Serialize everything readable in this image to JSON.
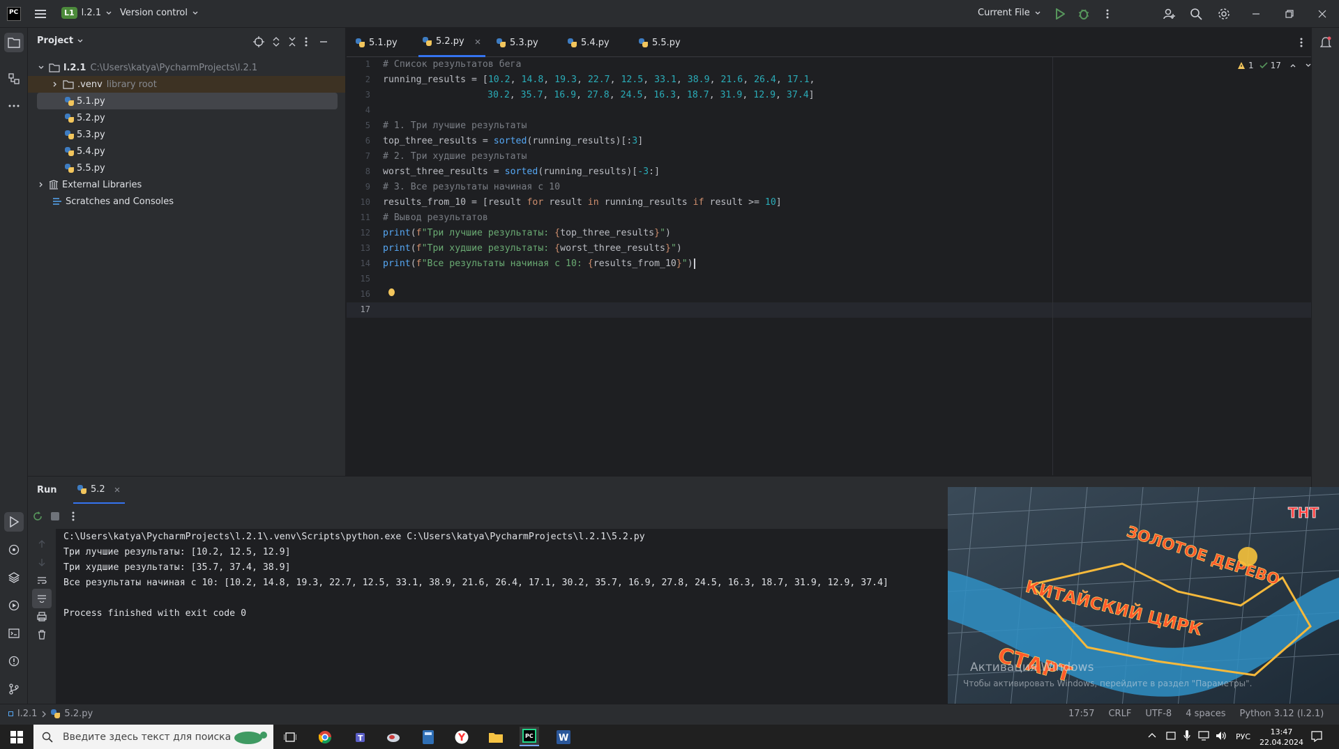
{
  "titlebar": {
    "project_badge": "L1",
    "project_name": "l.2.1",
    "vcs_label": "Version control",
    "run_config": "Current File"
  },
  "project_panel": {
    "title": "Project",
    "root_name": "l.2.1",
    "root_path": "C:\\Users\\katya\\PycharmProjects\\l.2.1",
    "venv_name": ".venv",
    "venv_note": "library root",
    "files": [
      "5.1.py",
      "5.2.py",
      "5.3.py",
      "5.4.py",
      "5.5.py"
    ],
    "external_libraries": "External Libraries",
    "scratches": "Scratches and Consoles"
  },
  "editor": {
    "tabs": [
      "5.1.py",
      "5.2.py",
      "5.3.py",
      "5.4.py",
      "5.5.py"
    ],
    "active_tab": "5.2.py",
    "inspection_warnings": "1",
    "inspection_ok": "17",
    "line_numbers": [
      "1",
      "2",
      "3",
      "4",
      "5",
      "6",
      "7",
      "8",
      "9",
      "10",
      "11",
      "12",
      "13",
      "14",
      "15",
      "16",
      "17"
    ],
    "code": {
      "c1": "# Список результатов бега",
      "l2a": "running_results = [",
      "nums1": [
        "10.2",
        "14.8",
        "19.3",
        "22.7",
        "12.5",
        "33.1",
        "38.9",
        "21.6",
        "26.4",
        "17.1"
      ],
      "nums2": [
        "30.2",
        "35.7",
        "16.9",
        "27.8",
        "24.5",
        "16.3",
        "18.7",
        "31.9",
        "12.9",
        "37.4"
      ],
      "c5": "# 1. Три лучшие результаты",
      "l6a": "top_three_results = ",
      "l6fn": "sorted",
      "l6b": "(running_results)[:",
      "l6n": "3",
      "l6c": "]",
      "c8": "# 2. Три худшие результаты",
      "l9a": "worst_three_results = ",
      "l9fn": "sorted",
      "l9b": "(running_results)[",
      "l9n": "-3",
      "l9c": ":]",
      "c11": "# 3. Все результаты начиная с 10",
      "l12a": "results_from_10 = [result ",
      "l12for": "for",
      "l12b": " result ",
      "l12in": "in",
      "l12c": " running_results ",
      "l12if": "if",
      "l12d": " result >= ",
      "l12n": "10",
      "l12e": "]",
      "c14": "# Вывод результатов",
      "print": "print",
      "s15": "\"Три лучшие результаты: ",
      "v15": "top_three_results",
      "s16": "\"Три худшие результаты: ",
      "v16": "worst_three_results",
      "s17": "\"Все результаты начиная с 10: ",
      "v17": "results_from_10"
    }
  },
  "run_panel": {
    "tab_run": "Run",
    "tab_config": "5.2",
    "output": [
      "C:\\Users\\katya\\PycharmProjects\\l.2.1\\.venv\\Scripts\\python.exe C:\\Users\\katya\\PycharmProjects\\l.2.1\\5.2.py",
      "Три лучшие результаты: [10.2, 12.5, 12.9]",
      "Три худшие результаты: [35.7, 37.4, 38.9]",
      "Все результаты начиная с 10: [10.2, 14.8, 19.3, 22.7, 12.5, 33.1, 38.9, 21.6, 26.4, 17.1, 30.2, 35.7, 16.9, 27.8, 24.5, 16.3, 18.7, 31.9, 12.9, 37.4]",
      "",
      "Process finished with exit code 0"
    ]
  },
  "statusbar": {
    "breadcrumb_project": "l.2.1",
    "breadcrumb_file": "5.2.py",
    "position": "17:57",
    "line_sep": "CRLF",
    "encoding": "UTF-8",
    "indent": "4 spaces",
    "interpreter": "Python 3.12 (l.2.1)"
  },
  "video_overlay": {
    "channel_logo": "ТНТ",
    "map_label_1": "КИТАЙСКИЙ ЦИРК",
    "map_label_2": "ЗОЛОТОЕ ДЕРЕВО",
    "map_label_3": "СТАРТ",
    "watermark": "Активация Windows",
    "watermark_sub": "Чтобы активировать Windows, перейдите в раздел \"Параметры\"."
  },
  "taskbar": {
    "search_placeholder": "Введите здесь текст для поиска",
    "language": "РУС",
    "time": "13:47",
    "date": "22.04.2024"
  },
  "colors": {
    "accent": "#3574f0",
    "background": "#1e1f22",
    "panel": "#2b2d30"
  }
}
